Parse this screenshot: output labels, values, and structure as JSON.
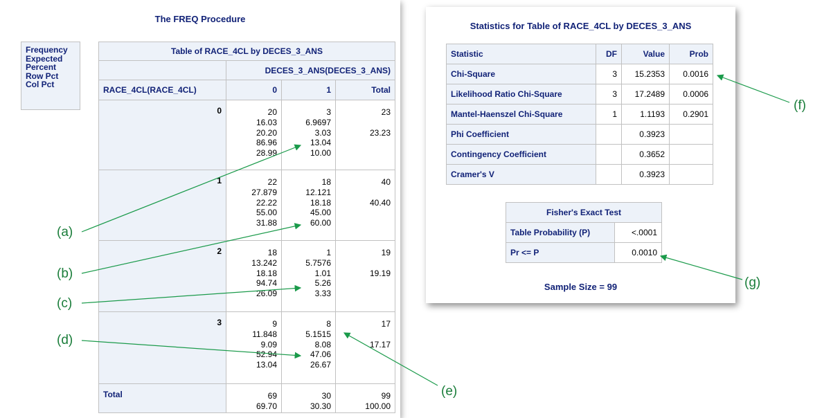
{
  "left_panel": {
    "title": "The FREQ Procedure",
    "legend": [
      "Frequency",
      "Expected",
      "Percent",
      "Row Pct",
      "Col Pct"
    ],
    "table": {
      "caption": "Table of RACE_4CL by DECES_3_ANS",
      "col_var": "DECES_3_ANS(DECES_3_ANS)",
      "row_var": "RACE_4CL(RACE_4CL)",
      "col_headers": [
        "0",
        "1",
        "Total"
      ],
      "rows": [
        {
          "label": "0",
          "c0": [
            "20",
            "16.03",
            "20.20",
            "86.96",
            "28.99"
          ],
          "c1": [
            "3",
            "6.9697",
            "3.03",
            "13.04",
            "10.00"
          ],
          "total": [
            "23",
            "",
            "23.23"
          ]
        },
        {
          "label": "1",
          "c0": [
            "22",
            "27.879",
            "22.22",
            "55.00",
            "31.88"
          ],
          "c1": [
            "18",
            "12.121",
            "18.18",
            "45.00",
            "60.00"
          ],
          "total": [
            "40",
            "",
            "40.40"
          ]
        },
        {
          "label": "2",
          "c0": [
            "18",
            "13.242",
            "18.18",
            "94.74",
            "26.09"
          ],
          "c1": [
            "1",
            "5.7576",
            "1.01",
            "5.26",
            "3.33"
          ],
          "total": [
            "19",
            "",
            "19.19"
          ]
        },
        {
          "label": "3",
          "c0": [
            "9",
            "11.848",
            "9.09",
            "52.94",
            "13.04"
          ],
          "c1": [
            "8",
            "5.1515",
            "8.08",
            "47.06",
            "26.67"
          ],
          "total": [
            "17",
            "",
            "17.17"
          ]
        }
      ],
      "total_row": {
        "label": "Total",
        "c0": [
          "69",
          "69.70"
        ],
        "c1": [
          "30",
          "30.30"
        ],
        "total": [
          "99",
          "100.00"
        ]
      }
    }
  },
  "right_panel": {
    "title": "Statistics for Table of RACE_4CL by DECES_3_ANS",
    "stats_headers": [
      "Statistic",
      "DF",
      "Value",
      "Prob"
    ],
    "stats_rows": [
      [
        "Chi-Square",
        "3",
        "15.2353",
        "0.0016"
      ],
      [
        "Likelihood Ratio Chi-Square",
        "3",
        "17.2489",
        "0.0006"
      ],
      [
        "Mantel-Haenszel Chi-Square",
        "1",
        "1.1193",
        "0.2901"
      ],
      [
        "Phi Coefficient",
        "",
        "0.3923",
        ""
      ],
      [
        "Contingency Coefficient",
        "",
        "0.3652",
        ""
      ],
      [
        "Cramer's V",
        "",
        "0.3923",
        ""
      ]
    ],
    "fisher": {
      "title": "Fisher's Exact Test",
      "rows": [
        [
          "Table Probability (P)",
          "<.0001"
        ],
        [
          "Pr <= P",
          "0.0010"
        ]
      ]
    },
    "sample_size": "Sample Size = 99"
  },
  "callouts": {
    "a": "(a)",
    "b": "(b)",
    "c": "(c)",
    "d": "(d)",
    "e": "(e)",
    "f": "(f)",
    "g": "(g)",
    "color": "#1a7d3a"
  }
}
